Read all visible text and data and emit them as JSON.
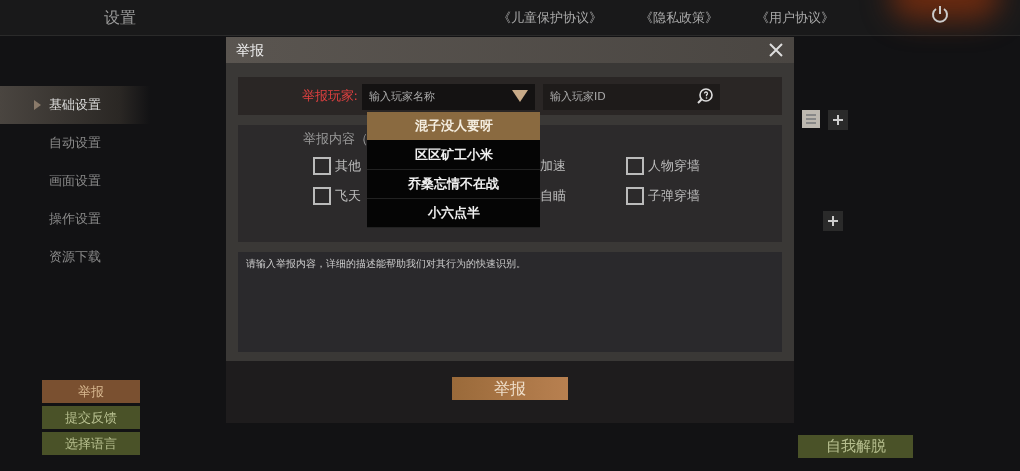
{
  "header": {
    "title": "设置",
    "links": [
      "《儿童保护协议》",
      "《隐私政策》",
      "《用户协议》"
    ]
  },
  "sidebar": {
    "items": [
      {
        "label": "基础设置",
        "selected": true
      },
      {
        "label": "自动设置",
        "selected": false
      },
      {
        "label": "画面设置",
        "selected": false
      },
      {
        "label": "操作设置",
        "selected": false
      },
      {
        "label": "资源下载",
        "selected": false
      }
    ]
  },
  "sidebar_buttons": [
    {
      "label": "举报",
      "kind": "report"
    },
    {
      "label": "提交反馈",
      "kind": "normal"
    },
    {
      "label": "选择语言",
      "kind": "normal"
    }
  ],
  "self_unstuck_button": "自我解脱",
  "dialog": {
    "title": "举报",
    "player_label": "举报玩家:",
    "name_placeholder": "输入玩家名称",
    "id_placeholder": "输入玩家ID",
    "dropdown": [
      {
        "label": "混子没人要呀",
        "selected": true
      },
      {
        "label": "区区矿工小米",
        "selected": false
      },
      {
        "label": "乔桑忘情不在战",
        "selected": false
      },
      {
        "label": "小六点半",
        "selected": false
      }
    ],
    "content_label": "举报内容（",
    "options": [
      {
        "label": "其他",
        "kind": "checkbox",
        "checked": false
      },
      {
        "label": "加速",
        "kind": "label"
      },
      {
        "label": "人物穿墙",
        "kind": "checkbox",
        "checked": false
      },
      {
        "label": "飞天",
        "kind": "checkbox",
        "checked": false
      },
      {
        "label": "自瞄",
        "kind": "label"
      },
      {
        "label": "子弹穿墙",
        "kind": "checkbox",
        "checked": false
      }
    ],
    "description_placeholder": "请输入举报内容，详细的描述能帮助我们对其行为的快速识别。",
    "submit": "举报"
  }
}
